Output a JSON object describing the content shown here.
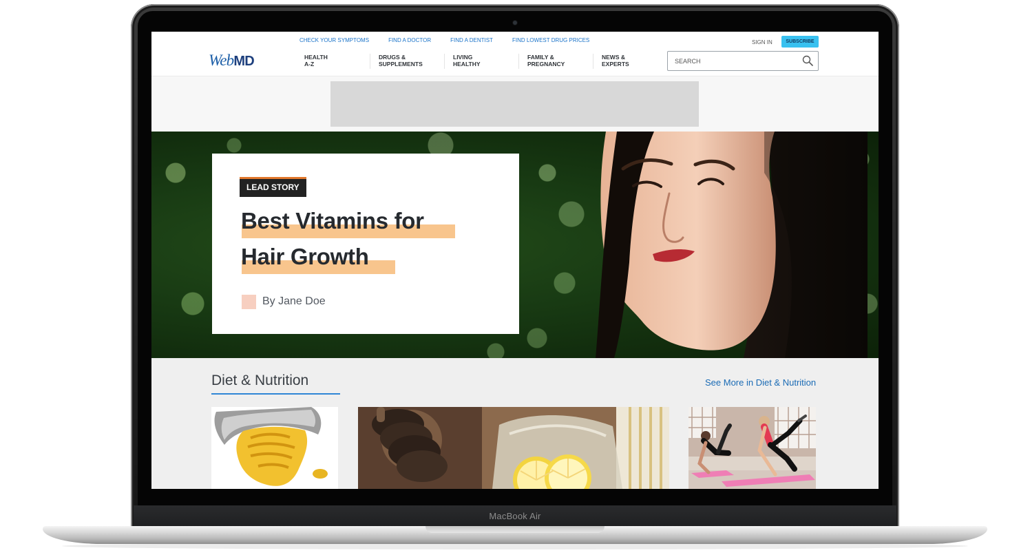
{
  "device": {
    "model_label": "MacBook Air"
  },
  "site": {
    "logo": {
      "web": "Web",
      "md": "MD"
    },
    "utility_links": [
      "CHECK YOUR SYMPTOMS",
      "FIND A DOCTOR",
      "FIND A DENTIST",
      "FIND LOWEST DRUG PRICES"
    ],
    "sign_in": "SIGN IN",
    "subscribe": "SUBSCRIBE",
    "nav": [
      "HEALTH\nA-Z",
      "DRUGS &\nSUPPLEMENTS",
      "LIVING\nHEALTHY",
      "FAMILY &\nPREGNANCY",
      "NEWS &\nEXPERTS"
    ],
    "search": {
      "placeholder": "SEARCH",
      "value": ""
    }
  },
  "hero": {
    "badge": "LEAD STORY",
    "title_line_1": "Best Vitamins for",
    "title_line_2": "Hair Growth",
    "byline": "By Jane Doe"
  },
  "section": {
    "title": "Diet & Nutrition",
    "see_more": "See More in Diet & Nutrition"
  },
  "colors": {
    "brand_blue": "#1d5fa8",
    "subscribe_bg": "#39c1f0",
    "badge_accent": "#e1772c",
    "highlight": "#f8c58d",
    "link_blue": "#1a6bb5"
  },
  "icons": {
    "search": "search-icon"
  }
}
